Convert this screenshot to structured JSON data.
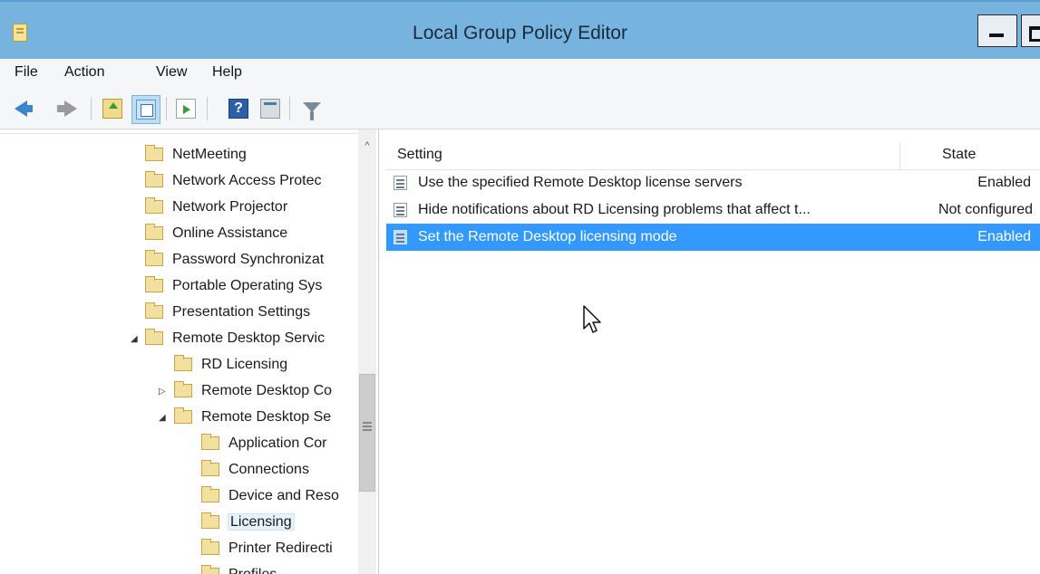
{
  "window": {
    "title": "Local Group Policy Editor"
  },
  "menu": [
    "File",
    "Action",
    "View",
    "Help"
  ],
  "toolbar": {
    "icons": [
      "back-icon",
      "forward-icon",
      "up-folder-icon",
      "show-tree-icon",
      "export-list-icon",
      "help-icon",
      "properties-icon",
      "filter-icon"
    ],
    "help_glyph": "?"
  },
  "tree": {
    "items": [
      {
        "label": "NetMeeting",
        "expander": ""
      },
      {
        "label": "Network Access Protec",
        "expander": ""
      },
      {
        "label": "Network Projector",
        "expander": ""
      },
      {
        "label": "Online Assistance",
        "expander": ""
      },
      {
        "label": "Password Synchronizat",
        "expander": ""
      },
      {
        "label": "Portable Operating Sys",
        "expander": ""
      },
      {
        "label": "Presentation Settings",
        "expander": ""
      },
      {
        "label": "Remote Desktop Servic",
        "expander": "◢"
      },
      {
        "label": "RD Licensing",
        "expander": ""
      },
      {
        "label": "Remote Desktop Co",
        "expander": "▷"
      },
      {
        "label": "Remote Desktop Se",
        "expander": "◢"
      },
      {
        "label": "Application Cor",
        "expander": ""
      },
      {
        "label": "Connections",
        "expander": ""
      },
      {
        "label": "Device and Reso",
        "expander": ""
      },
      {
        "label": "Licensing",
        "expander": ""
      },
      {
        "label": "Printer Redirecti",
        "expander": ""
      },
      {
        "label": "Profiles",
        "expander": ""
      }
    ],
    "selected_label": "Licensing",
    "scroll_up_glyph": "^",
    "scroll_grip_glyph": "≡"
  },
  "list": {
    "columns": {
      "setting": "Setting",
      "state": "State"
    },
    "rows": [
      {
        "setting": "Use the specified Remote Desktop license servers",
        "state": "Enabled",
        "selected": false
      },
      {
        "setting": "Hide notifications about RD Licensing problems that affect t...",
        "state": "Not configured",
        "selected": false
      },
      {
        "setting": "Set the Remote Desktop licensing mode",
        "state": "Enabled",
        "selected": true
      }
    ]
  },
  "colors": {
    "titlebar": "#76b3de",
    "selection": "#3399ff",
    "folder": "#f2e0a0"
  }
}
